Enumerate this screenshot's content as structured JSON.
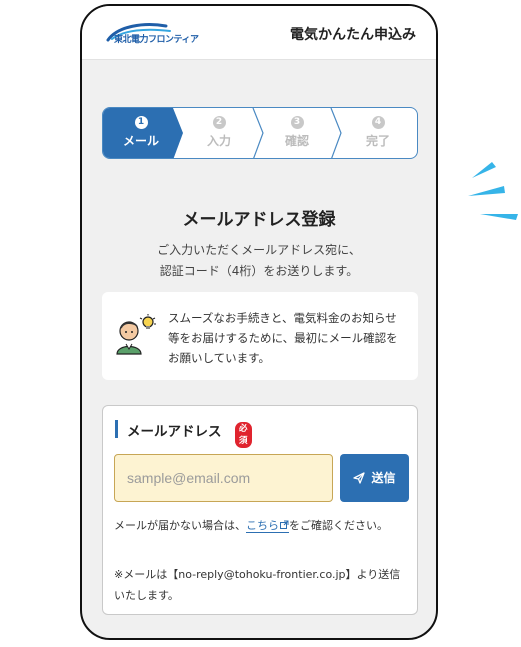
{
  "header": {
    "logo_text": "東北電力フロンティア",
    "title": "電気かんたん申込み"
  },
  "steps": [
    {
      "num": "1",
      "label": "メール",
      "active": true
    },
    {
      "num": "2",
      "label": "入力",
      "active": false
    },
    {
      "num": "3",
      "label": "確認",
      "active": false
    },
    {
      "num": "4",
      "label": "完了",
      "active": false
    }
  ],
  "main": {
    "title": "メールアドレス登録",
    "desc_line1": "ご入力いただくメールアドレス宛に、",
    "desc_line2": "認証コード（4桁）をお送りします。",
    "info_text": "スムーズなお手続きと、電気料金のお知らせ等をお届けするために、最初にメール確認をお願いしています。"
  },
  "form": {
    "label": "メールアドレス",
    "required": "必須",
    "placeholder": "sample@email.com",
    "value": "",
    "send_label": "送信",
    "note_prefix": "メールが届かない場合は、",
    "note_link": "こちら",
    "note_suffix": "をご確認ください。",
    "note2": "※メールは【no-reply@tohoku-frontier.co.jp】より送信いたします。"
  },
  "colors": {
    "accent": "#2c6fb2",
    "input_bg": "#fdf3d2",
    "required": "#e0242e",
    "page_bg": "#f0f0f0"
  },
  "icons": [
    "logo-swoosh-icon",
    "lightbulb-person-icon",
    "paper-plane-icon",
    "external-link-icon",
    "decorative-burst-icon"
  ]
}
